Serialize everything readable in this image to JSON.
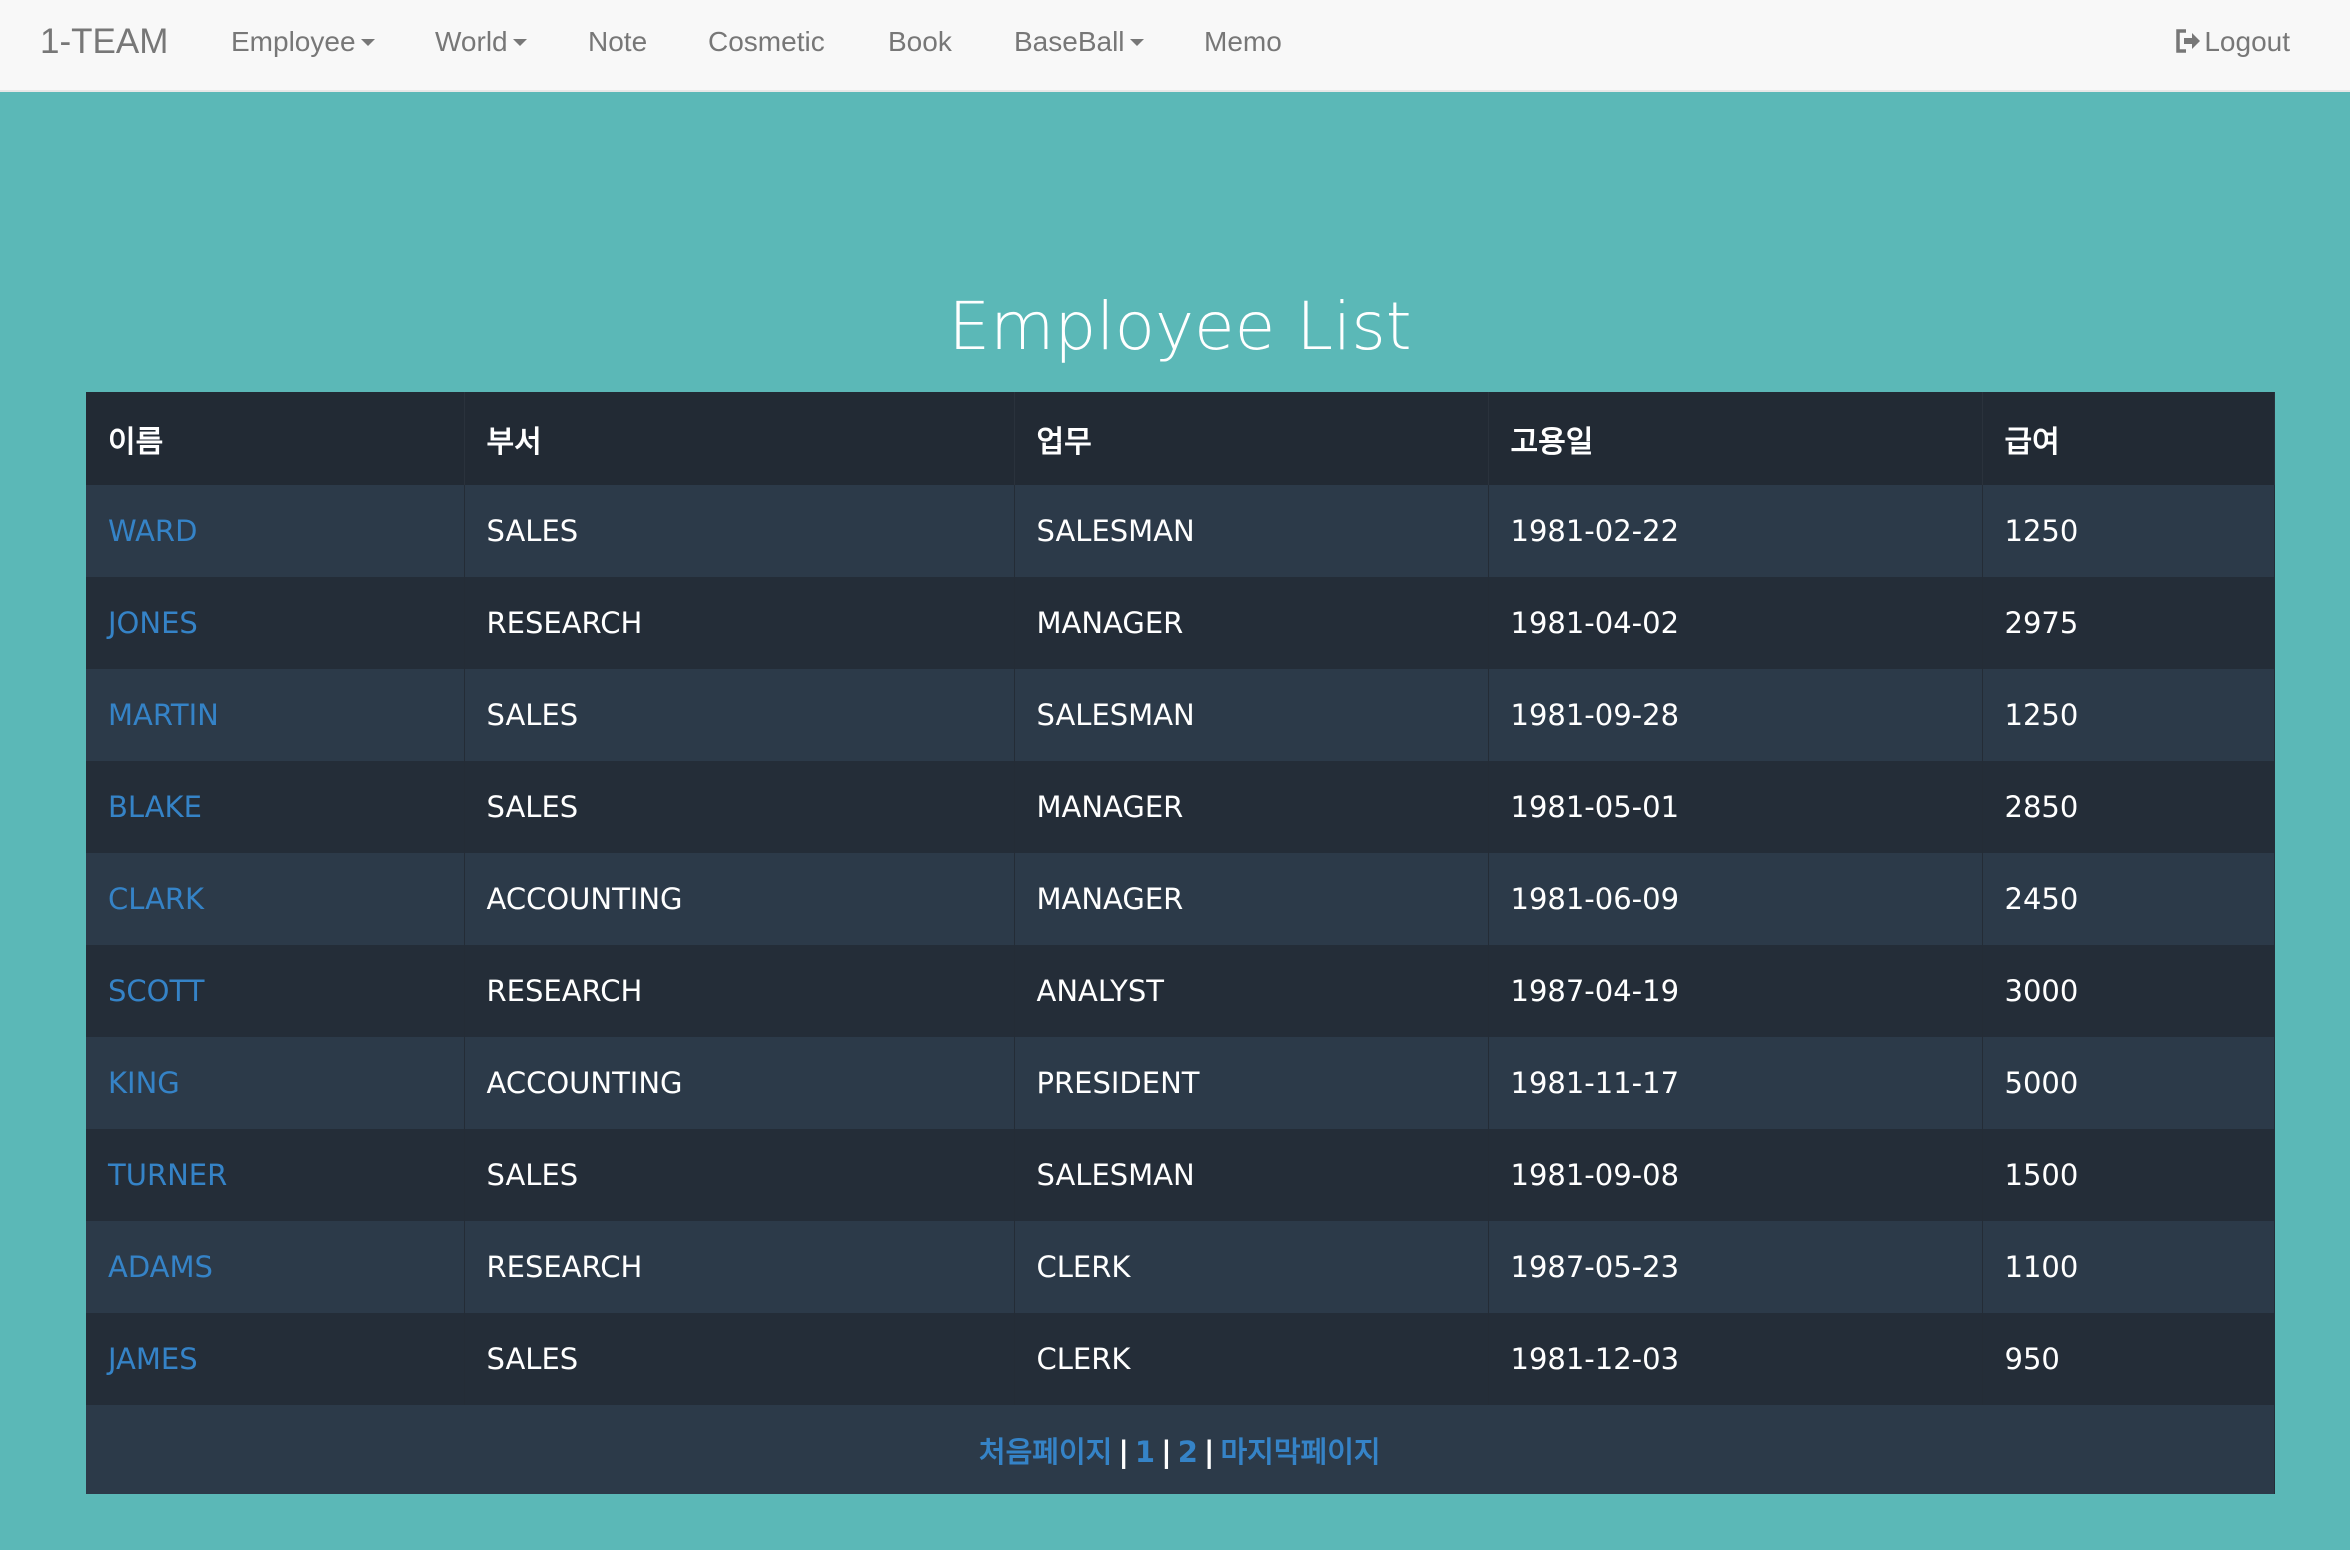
{
  "navbar": {
    "brand": "1-TEAM",
    "items": [
      {
        "label": "Employee",
        "dropdown": true
      },
      {
        "label": "World",
        "dropdown": true
      },
      {
        "label": "Note",
        "dropdown": false
      },
      {
        "label": "Cosmetic",
        "dropdown": false
      },
      {
        "label": "Book",
        "dropdown": false
      },
      {
        "label": "BaseBall",
        "dropdown": true
      },
      {
        "label": "Memo",
        "dropdown": false
      }
    ],
    "logout_label": "Logout",
    "logout_icon": "log-out-icon"
  },
  "page": {
    "title": "Employee List"
  },
  "table": {
    "headers": [
      "이름",
      "부서",
      "업무",
      "고용일",
      "급여"
    ],
    "rows": [
      {
        "name": "WARD",
        "dept": "SALES",
        "job": "SALESMAN",
        "hiredate": "1981-02-22",
        "sal": "1250"
      },
      {
        "name": "JONES",
        "dept": "RESEARCH",
        "job": "MANAGER",
        "hiredate": "1981-04-02",
        "sal": "2975"
      },
      {
        "name": "MARTIN",
        "dept": "SALES",
        "job": "SALESMAN",
        "hiredate": "1981-09-28",
        "sal": "1250"
      },
      {
        "name": "BLAKE",
        "dept": "SALES",
        "job": "MANAGER",
        "hiredate": "1981-05-01",
        "sal": "2850"
      },
      {
        "name": "CLARK",
        "dept": "ACCOUNTING",
        "job": "MANAGER",
        "hiredate": "1981-06-09",
        "sal": "2450"
      },
      {
        "name": "SCOTT",
        "dept": "RESEARCH",
        "job": "ANALYST",
        "hiredate": "1987-04-19",
        "sal": "3000"
      },
      {
        "name": "KING",
        "dept": "ACCOUNTING",
        "job": "PRESIDENT",
        "hiredate": "1981-11-17",
        "sal": "5000"
      },
      {
        "name": "TURNER",
        "dept": "SALES",
        "job": "SALESMAN",
        "hiredate": "1981-09-08",
        "sal": "1500"
      },
      {
        "name": "ADAMS",
        "dept": "RESEARCH",
        "job": "CLERK",
        "hiredate": "1987-05-23",
        "sal": "1100"
      },
      {
        "name": "JAMES",
        "dept": "SALES",
        "job": "CLERK",
        "hiredate": "1981-12-03",
        "sal": "950"
      }
    ]
  },
  "pagination": {
    "first": "처음페이지",
    "pages": [
      "1",
      "2"
    ],
    "last": "마지막페이지",
    "separator": "|"
  },
  "colors": {
    "background": "#5bb8b7",
    "navbar": "#f8f8f8",
    "table_header": "#222a34",
    "row_odd": "#2c3a49",
    "row_even": "#242d38",
    "link": "#3583c7"
  }
}
